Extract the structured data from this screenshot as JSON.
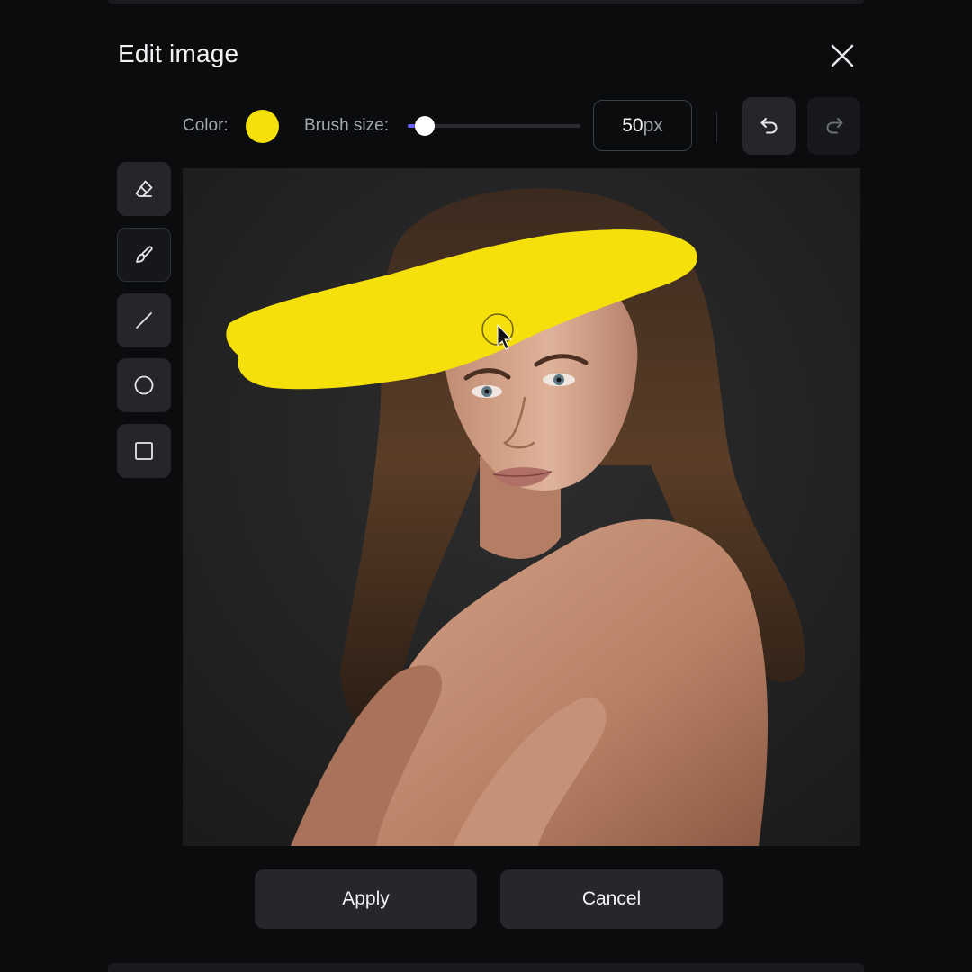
{
  "dialog": {
    "title": "Edit image",
    "close_icon": "close-icon"
  },
  "toolbar": {
    "color_label": "Color:",
    "color_value": "#f5e00c",
    "brush_label": "Brush size:",
    "brush_fraction": 0.1,
    "brush_size_value": "50",
    "brush_size_unit": "px",
    "undo_icon": "undo-icon",
    "redo_icon": "redo-icon",
    "accent_color": "#6d62ff"
  },
  "tools": [
    {
      "name": "eraser",
      "icon": "eraser-icon",
      "active": false
    },
    {
      "name": "brush",
      "icon": "brush-icon",
      "active": true
    },
    {
      "name": "line",
      "icon": "line-icon",
      "active": false
    },
    {
      "name": "circle",
      "icon": "circle-icon",
      "active": false
    },
    {
      "name": "rectangle",
      "icon": "rectangle-icon",
      "active": false
    }
  ],
  "actions": {
    "apply_label": "Apply",
    "cancel_label": "Cancel"
  }
}
